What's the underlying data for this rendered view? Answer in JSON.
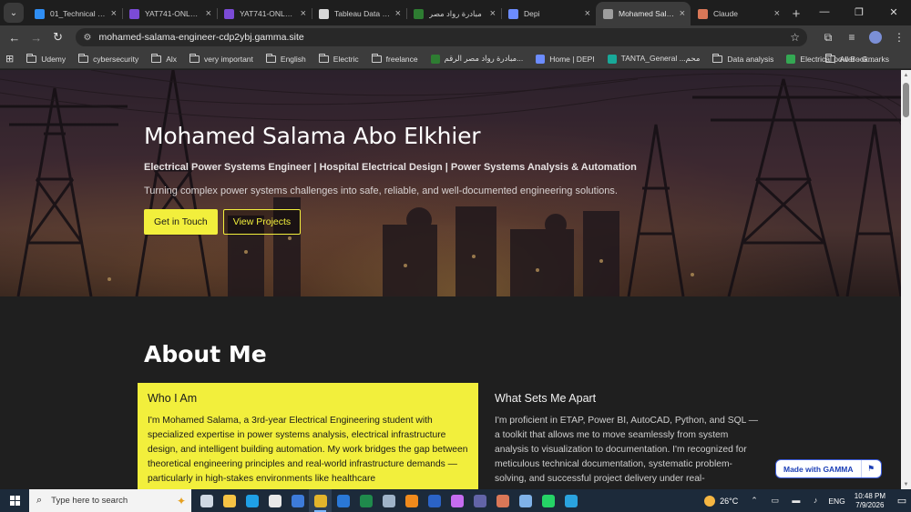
{
  "browser": {
    "tabs": [
      {
        "title": "01_Technical - O",
        "favicon_color": "#2f8ef4",
        "active": false
      },
      {
        "title": "YAT741-ONL4_D",
        "favicon_color": "#7b4bd6",
        "active": false
      },
      {
        "title": "YAT741-ONL4_D",
        "favicon_color": "#7b4bd6",
        "active": false
      },
      {
        "title": "Tableau Data Re",
        "favicon_color": "#d9d9d9",
        "active": false
      },
      {
        "title": "مبادرة رواد مصر",
        "favicon_color": "#2e7d32",
        "active": false
      },
      {
        "title": "Depi",
        "favicon_color": "#6c8cff",
        "active": false
      },
      {
        "title": "Mohamed Salam",
        "favicon_color": "#9e9e9e",
        "active": true
      },
      {
        "title": "Claude",
        "favicon_color": "#d97757",
        "active": false
      }
    ],
    "url": "mohamed-salama-engineer-cdp2ybj.gamma.site",
    "bookmarks": [
      {
        "label": "Udemy",
        "kind": "folder"
      },
      {
        "label": "cybersecurity",
        "kind": "folder"
      },
      {
        "label": "Alx",
        "kind": "folder"
      },
      {
        "label": "very  important",
        "kind": "folder"
      },
      {
        "label": "English",
        "kind": "folder"
      },
      {
        "label": "Electric",
        "kind": "folder"
      },
      {
        "label": "freelance",
        "kind": "folder"
      },
      {
        "label": "مبادرة رواد مصر الرقم...",
        "kind": "site",
        "color": "#2e7d32"
      },
      {
        "label": "Home | DEPI",
        "kind": "site",
        "color": "#6c8cff"
      },
      {
        "label": "TANTA_General ...محم",
        "kind": "site",
        "color": "#18a999"
      },
      {
        "label": "Data analysis",
        "kind": "folder"
      },
      {
        "label": "Electrical power - G...",
        "kind": "site",
        "color": "#34a853"
      }
    ],
    "all_bookmarks": "All Bookmarks"
  },
  "hero": {
    "title": "Mohamed Salama Abo Elkhier",
    "subtitle": "Electrical Power Systems Engineer | Hospital Electrical Design | Power Systems Analysis & Automation",
    "tagline": "Turning complex power systems challenges into safe, reliable, and well-documented engineering solutions.",
    "primary_button": "Get in Touch",
    "secondary_button": "View Projects"
  },
  "about": {
    "title": "About Me",
    "who": {
      "heading": "Who I Am",
      "text": "I'm Mohamed Salama, a 3rd-year Electrical Engineering student with specialized expertise in power systems analysis, electrical infrastructure design, and intelligent building automation. My work bridges the gap between theoretical engineering principles and real-world infrastructure demands — particularly in high-stakes environments like healthcare"
    },
    "apart": {
      "heading": "What Sets Me Apart",
      "text": "I'm proficient in ETAP, Power BI, AutoCAD, Python, and SQL — a toolkit that allows me to move seamlessly from system analysis to visualization to documentation. I'm recognized for meticulous technical documentation, systematic problem-solving, and successful project delivery under real-"
    }
  },
  "badge": {
    "label": "Made with GAMMA"
  },
  "taskbar": {
    "search_placeholder": "Type here to search",
    "apps": [
      {
        "name": "task-view",
        "color": "#cfd8e3"
      },
      {
        "name": "file-explorer",
        "color": "#f6c344"
      },
      {
        "name": "edge",
        "color": "#1fa0e6"
      },
      {
        "name": "store",
        "color": "#e8e8e8"
      },
      {
        "name": "photos",
        "color": "#3d7bd9"
      },
      {
        "name": "chrome",
        "color": "#e2b42b",
        "active": true
      },
      {
        "name": "mail",
        "color": "#2a78d6"
      },
      {
        "name": "excel",
        "color": "#1f8a4c"
      },
      {
        "name": "keyboard",
        "color": "#9fb3c8"
      },
      {
        "name": "vlc",
        "color": "#f08a1c"
      },
      {
        "name": "word",
        "color": "#2b63c6"
      },
      {
        "name": "copilot",
        "color": "#c56cf0"
      },
      {
        "name": "teams",
        "color": "#6264a7"
      },
      {
        "name": "claude",
        "color": "#d97757"
      },
      {
        "name": "snipping",
        "color": "#7fb2e8"
      },
      {
        "name": "whatsapp",
        "color": "#25d366"
      },
      {
        "name": "telegram",
        "color": "#2aa3df"
      }
    ],
    "temperature": "26°C",
    "language": "ENG",
    "time": "10:48 PM",
    "date": "7/9/2026"
  }
}
